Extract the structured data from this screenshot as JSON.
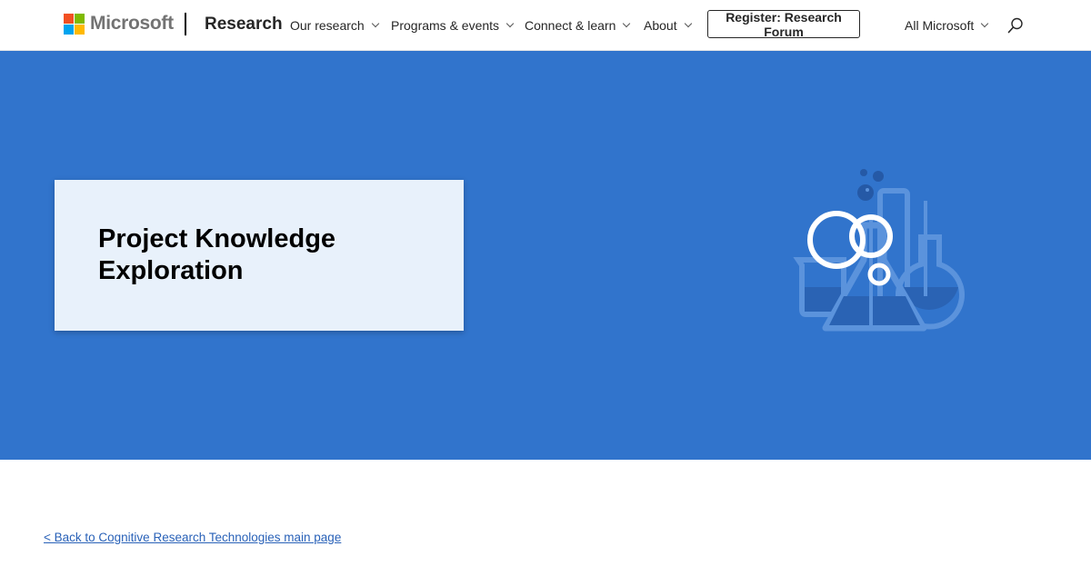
{
  "header": {
    "logo_text": "Microsoft",
    "brand": "Research",
    "nav": [
      {
        "label": "Our research"
      },
      {
        "label": "Programs & events"
      },
      {
        "label": "Connect & learn"
      },
      {
        "label": "About"
      }
    ],
    "cta_label": "Register: Research Forum",
    "all_microsoft_label": "All Microsoft",
    "search_icon": "search-icon"
  },
  "hero": {
    "title": "Project Knowledge Exploration",
    "illustration": "lab-flasks-illustration",
    "background_color": "#3174cc",
    "card_color": "#e8f1fb"
  },
  "main": {
    "back_link": "< Back to Cognitive Research Technologies main page"
  }
}
